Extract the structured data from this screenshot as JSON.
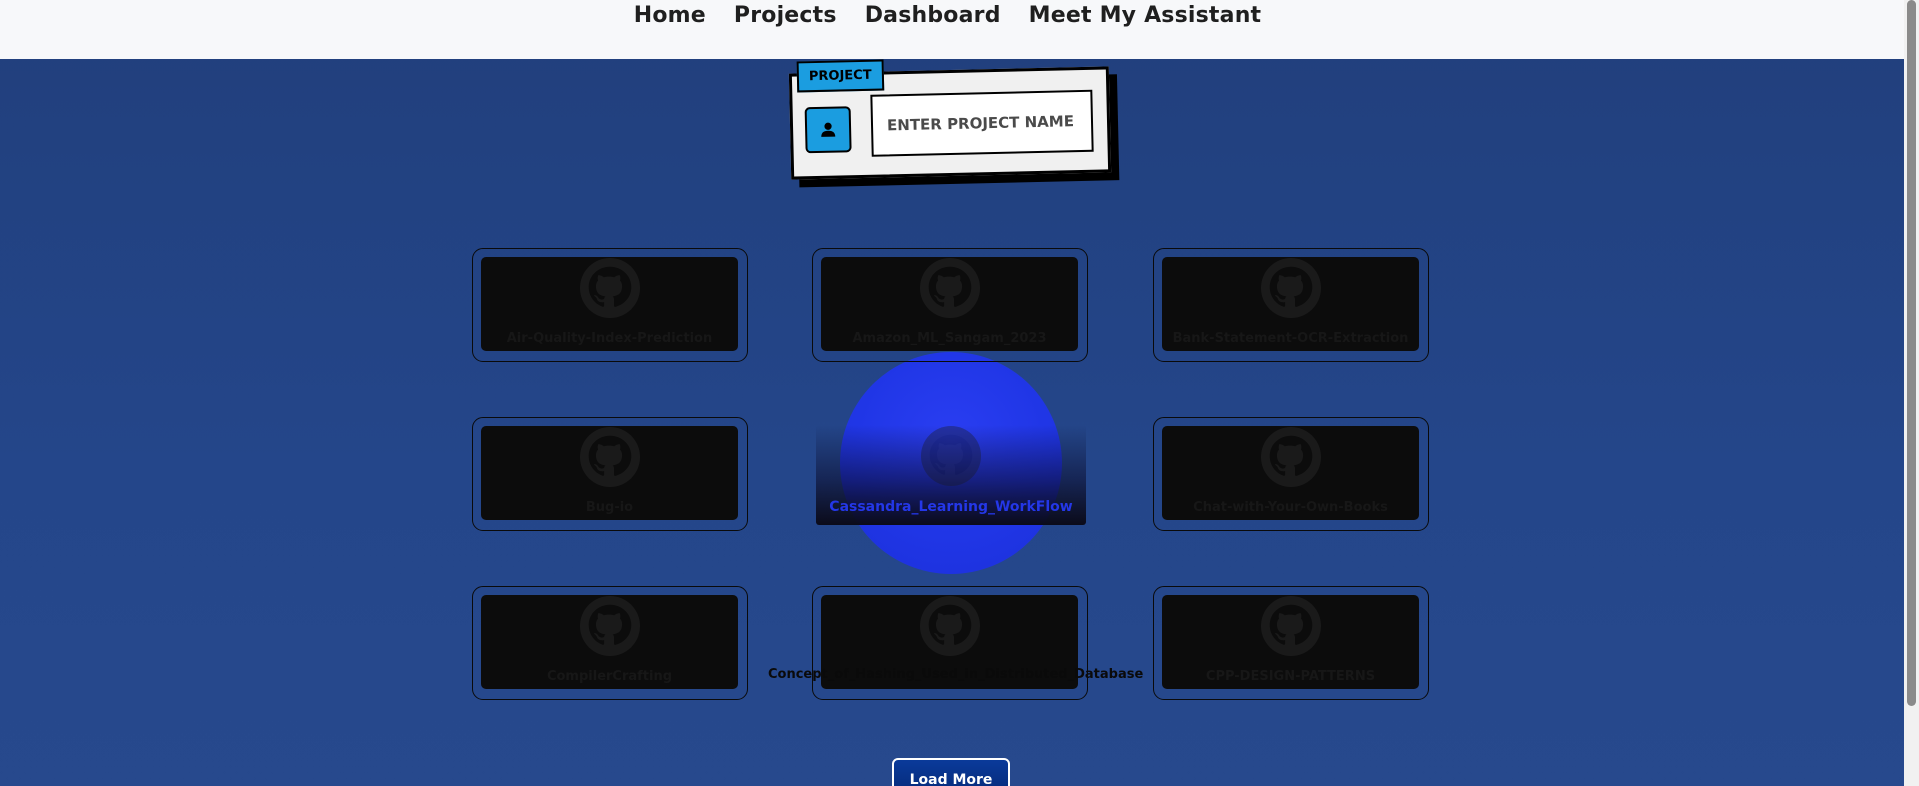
{
  "nav": {
    "links": [
      "Home",
      "Projects",
      "Dashboard",
      "Meet My Assistant"
    ]
  },
  "search": {
    "tag": "PROJECT",
    "placeholder": "ENTER PROJECT NAME",
    "value": ""
  },
  "projects": [
    {
      "title": "Air-Quality-Index-Prediction",
      "icon": "github-icon"
    },
    {
      "title": "Amazon_ML_Sangam_2023",
      "icon": "github-icon"
    },
    {
      "title": "Bank-Statement-OCR-Extraction",
      "icon": "github-icon"
    },
    {
      "title": "Bug-io",
      "icon": "github-icon"
    },
    {
      "title": "Cassandra_Learning_WorkFlow",
      "icon": "github-icon",
      "state": "hovered"
    },
    {
      "title": "Chat-with-Your-Own-Books",
      "icon": "github-icon"
    },
    {
      "title": "CompilerCrafting",
      "icon": "github-icon"
    },
    {
      "title": "Concept_of_Hashing_Used_in_Distributed_Database",
      "icon": "github-icon"
    },
    {
      "title": "CPP-DESIGN-PATTERNS",
      "icon": "github-icon"
    }
  ],
  "load_more": "Load More",
  "colors": {
    "background": "#24468a",
    "accent": "#1b9de0",
    "hover": "#2437e8",
    "card": "#0c0c0c"
  }
}
